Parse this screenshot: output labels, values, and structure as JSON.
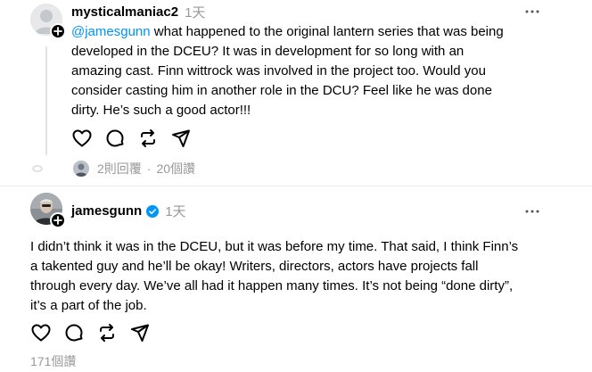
{
  "post1": {
    "username": "mysticalmaniac2",
    "time": "1天",
    "mention": "@jamesgunn",
    "lines": [
      " what happened to the original lantern series that was being",
      "developed in the DCEU? It was in development for so long with an",
      "amazing cast. Finn wittrock was involved in the project too. Would you",
      "consider casting him in another role in the DCU? Feel like he was done",
      "dirty. He’s such a good actor!!!"
    ],
    "replies": "2則回覆",
    "separator": "·",
    "views": "20個讚"
  },
  "post2": {
    "username": "jamesgunn",
    "time": "1天",
    "verified": true,
    "lines": [
      "I didn’t think it was in the DCEU, but it was before my time. That said, I think Finn’s",
      "a takented guy and he’ll be okay! Writers, directors, actors have projects fall",
      "through every day. We’ve all had it happen many times. It’s not being “done dirty”,",
      "it’s a part of the job."
    ],
    "likes": "171個讚"
  },
  "icons": {
    "like": "heart-icon",
    "comment": "comment-icon",
    "repost": "repost-icon",
    "share": "share-icon",
    "more": "more-icon",
    "follow": "plus-icon",
    "verified": "verified-badge-icon"
  },
  "colors": {
    "mention": "#0095f6",
    "verified": "#0095f6",
    "muted": "#999999"
  }
}
